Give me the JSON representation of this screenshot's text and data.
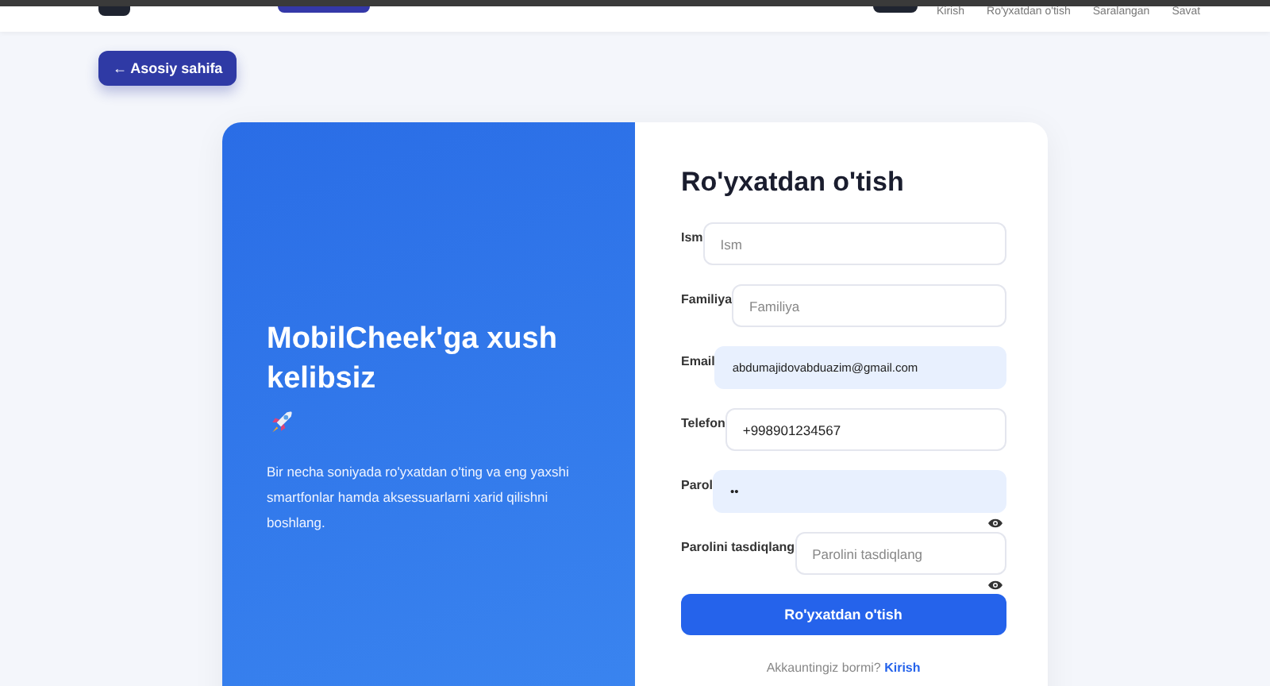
{
  "nav": {
    "links": [
      {
        "label": "Kirish"
      },
      {
        "label": "Ro'yxatdan o'tish"
      },
      {
        "label": "Saralangan"
      },
      {
        "label": "Savat"
      }
    ]
  },
  "back_button": {
    "label": "← Asosiy sahifa"
  },
  "welcome": {
    "title": "MobilCheek'ga xush kelibsiz",
    "text": "Bir necha soniyada ro'yxatdan o'ting va eng yaxshi smartfonlar hamda aksessuarlarni xarid qilishni boshlang."
  },
  "form": {
    "title": "Ro'yxatdan o'tish",
    "fields": [
      {
        "label": "Ism",
        "placeholder": "Ism",
        "kind": "text",
        "autofilled": false
      },
      {
        "label": "Familiya",
        "placeholder": "Familiya",
        "kind": "text",
        "autofilled": false
      },
      {
        "label": "Email",
        "value": "abdumajidovabduazim@gmail.com",
        "kind": "text",
        "autofilled": true
      },
      {
        "label": "Telefon",
        "value": "+998901234567",
        "kind": "text",
        "autofilled": false
      },
      {
        "label": "Parol",
        "value": "••",
        "kind": "password",
        "autofilled": true
      },
      {
        "label": "Parolini tasdiqlang",
        "placeholder": "Parolini tasdiqlang",
        "kind": "password",
        "autofilled": false
      }
    ],
    "submit": "Ro'yxatdan o'tish",
    "footer": {
      "text": "Akkauntingiz bormi?",
      "link": "Kirish"
    }
  }
}
